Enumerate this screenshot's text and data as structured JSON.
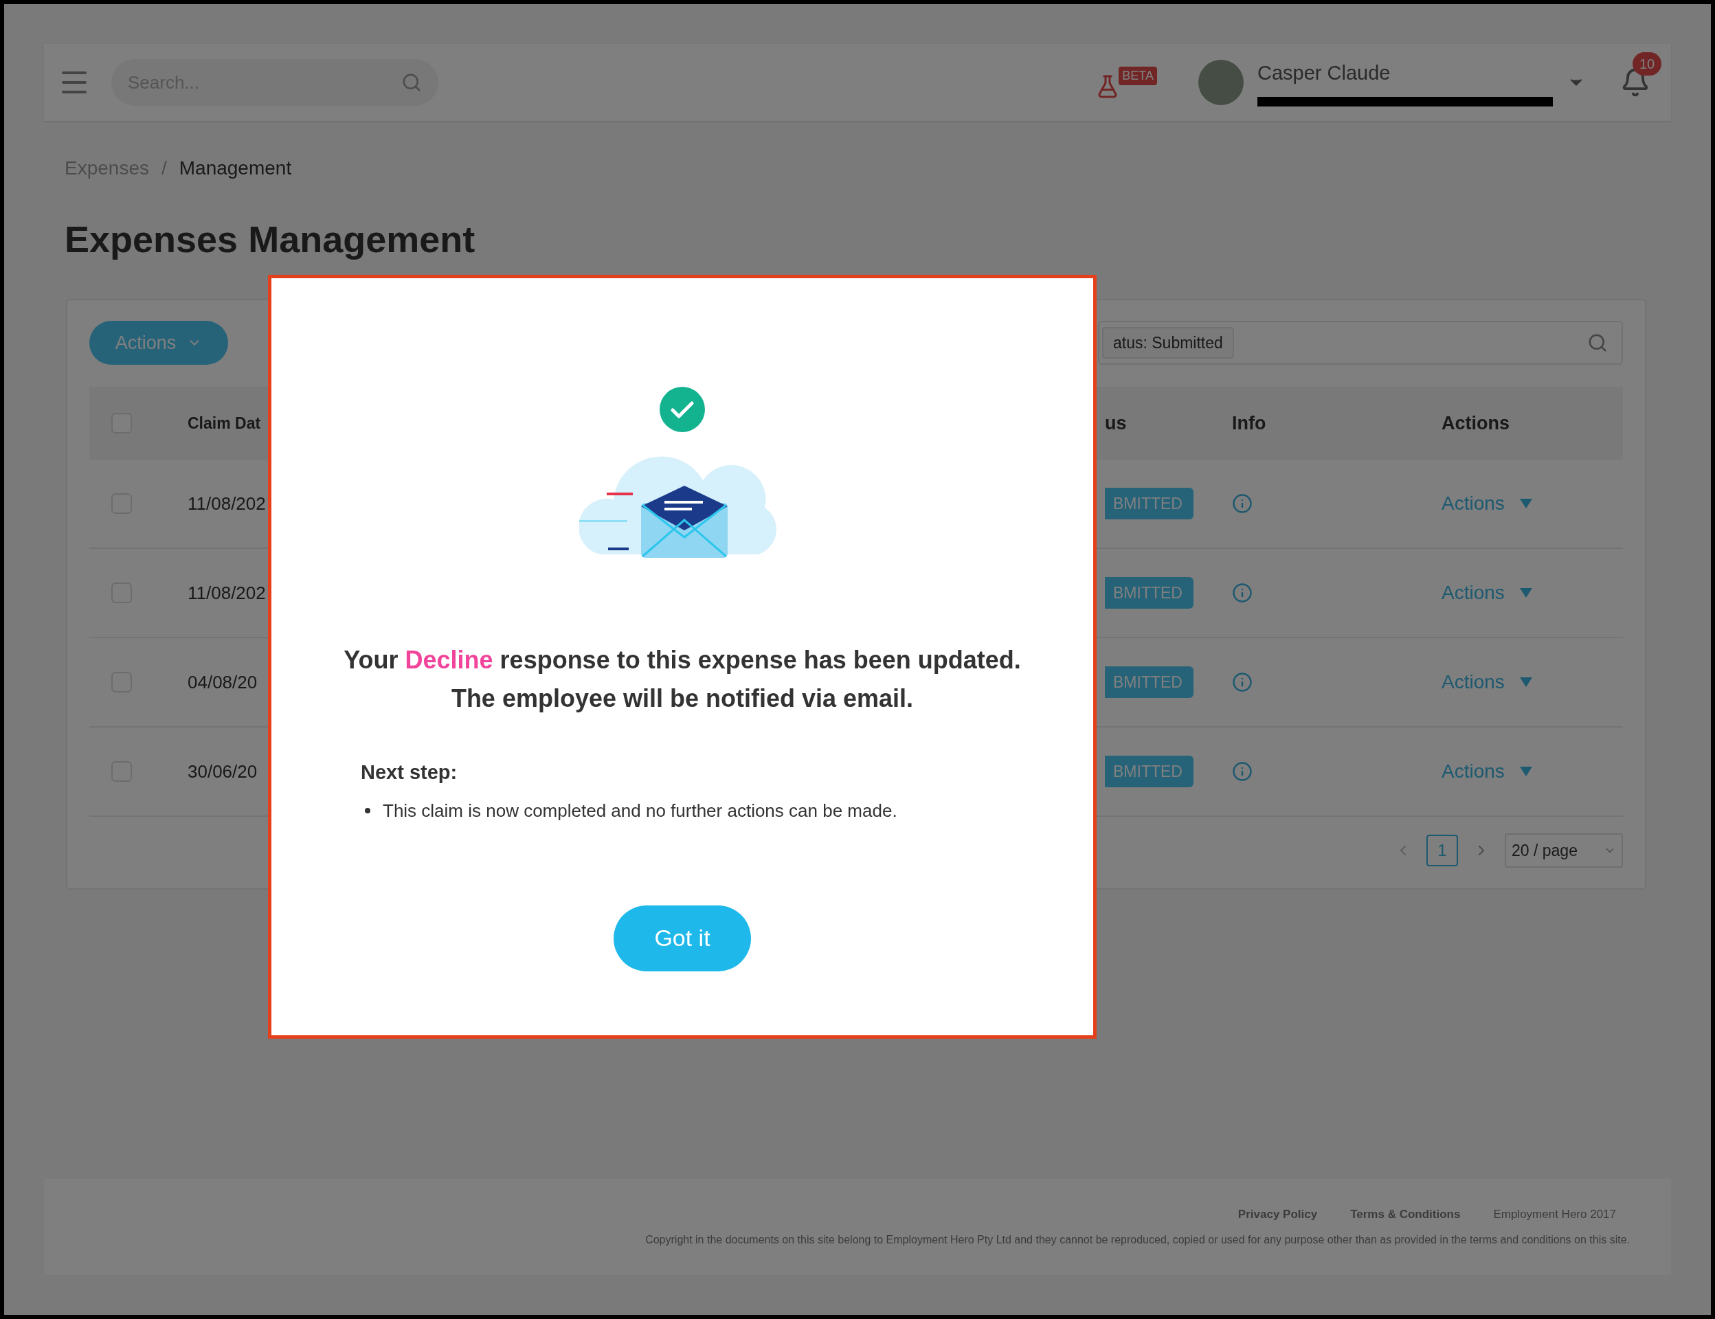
{
  "header": {
    "search": {
      "placeholder": "Search..."
    },
    "beta_badge": "BETA",
    "user": {
      "name": "Casper Claude"
    },
    "notifications": {
      "count": "10"
    }
  },
  "breadcrumb_separator": "/",
  "breadcrumb": [
    {
      "label": "Expenses",
      "current": false
    },
    {
      "label": "Management",
      "current": true
    }
  ],
  "page_title": "Expenses Management",
  "toolbar": {
    "actions_button": "Actions",
    "filter_chip": "atus: Submitted"
  },
  "table": {
    "select_all": {
      "checked": false
    },
    "columns": [
      "Claim Dat",
      "us",
      "Info",
      "Actions"
    ],
    "rows": [
      {
        "checked": false,
        "date": "11/08/202",
        "status": "BMITTED",
        "action": "Actions"
      },
      {
        "checked": false,
        "date": "11/08/202",
        "status": "BMITTED",
        "action": "Actions"
      },
      {
        "checked": false,
        "date": "04/08/20",
        "status": "BMITTED",
        "action": "Actions"
      },
      {
        "checked": false,
        "date": "30/06/20",
        "status": "BMITTED",
        "action": "Actions"
      }
    ]
  },
  "pagination": {
    "pages": [
      {
        "label": "1",
        "selected": true
      }
    ],
    "page_size": "20 / page"
  },
  "footer": {
    "links": [
      "Privacy Policy",
      "Terms & Conditions"
    ],
    "brand": "Employment Hero 2017",
    "copyright": "Copyright in the documents on this site belong to Employment Hero Pty Ltd and they cannot be reproduced, copied or used for any purpose other than as provided in the terms and conditions on this site."
  },
  "dialog": {
    "message": {
      "before": "Your ",
      "highlight": "Decline",
      "after": " response to this expense has been updated.",
      "line2": "The employee will be notified via email."
    },
    "next_step": {
      "heading": "Next step:",
      "items": [
        "This claim is now completed and no further actions can be made."
      ]
    },
    "button": "Got it"
  }
}
